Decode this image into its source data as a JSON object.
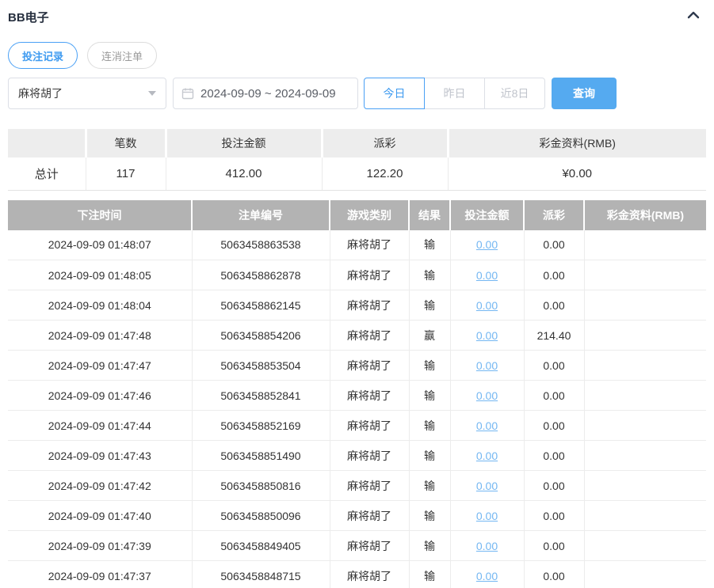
{
  "page": {
    "title": "BB电子"
  },
  "header": {
    "collapse_icon": "chevron-up-icon"
  },
  "tabs": [
    {
      "label": "投注记录",
      "active": true
    },
    {
      "label": "连消注单",
      "active": false
    }
  ],
  "filters": {
    "game_select": {
      "value": "麻将胡了",
      "icon": "caret-down-icon"
    },
    "date_range": {
      "value": "2024-09-09 ~ 2024-09-09",
      "icon": "calendar-icon"
    },
    "quick_buttons": [
      {
        "label": "今日",
        "active": true
      },
      {
        "label": "昨日",
        "active": false
      },
      {
        "label": "近8日",
        "active": false
      }
    ],
    "query_label": "查询"
  },
  "summary": {
    "columns": [
      "",
      "笔数",
      "投注金额",
      "派彩",
      "彩金资料(RMB)"
    ],
    "row": {
      "label": "总计",
      "count": "117",
      "bet_amount": "412.00",
      "payout": "122.20",
      "jackpot": "¥0.00"
    }
  },
  "table": {
    "columns": [
      "下注时间",
      "注单编号",
      "游戏类别",
      "结果",
      "投注金额",
      "派彩",
      "彩金资料(RMB)"
    ],
    "rows": [
      {
        "time": "2024-09-09 01:48:07",
        "order_no": "5063458863538",
        "game": "麻将胡了",
        "result": "输",
        "bet": "0.00",
        "payout": "0.00",
        "jackpot": ""
      },
      {
        "time": "2024-09-09 01:48:05",
        "order_no": "5063458862878",
        "game": "麻将胡了",
        "result": "输",
        "bet": "0.00",
        "payout": "0.00",
        "jackpot": ""
      },
      {
        "time": "2024-09-09 01:48:04",
        "order_no": "5063458862145",
        "game": "麻将胡了",
        "result": "输",
        "bet": "0.00",
        "payout": "0.00",
        "jackpot": ""
      },
      {
        "time": "2024-09-09 01:47:48",
        "order_no": "5063458854206",
        "game": "麻将胡了",
        "result": "赢",
        "bet": "0.00",
        "payout": "214.40",
        "jackpot": ""
      },
      {
        "time": "2024-09-09 01:47:47",
        "order_no": "5063458853504",
        "game": "麻将胡了",
        "result": "输",
        "bet": "0.00",
        "payout": "0.00",
        "jackpot": ""
      },
      {
        "time": "2024-09-09 01:47:46",
        "order_no": "5063458852841",
        "game": "麻将胡了",
        "result": "输",
        "bet": "0.00",
        "payout": "0.00",
        "jackpot": ""
      },
      {
        "time": "2024-09-09 01:47:44",
        "order_no": "5063458852169",
        "game": "麻将胡了",
        "result": "输",
        "bet": "0.00",
        "payout": "0.00",
        "jackpot": ""
      },
      {
        "time": "2024-09-09 01:47:43",
        "order_no": "5063458851490",
        "game": "麻将胡了",
        "result": "输",
        "bet": "0.00",
        "payout": "0.00",
        "jackpot": ""
      },
      {
        "time": "2024-09-09 01:47:42",
        "order_no": "5063458850816",
        "game": "麻将胡了",
        "result": "输",
        "bet": "0.00",
        "payout": "0.00",
        "jackpot": ""
      },
      {
        "time": "2024-09-09 01:47:40",
        "order_no": "5063458850096",
        "game": "麻将胡了",
        "result": "输",
        "bet": "0.00",
        "payout": "0.00",
        "jackpot": ""
      },
      {
        "time": "2024-09-09 01:47:39",
        "order_no": "5063458849405",
        "game": "麻将胡了",
        "result": "输",
        "bet": "0.00",
        "payout": "0.00",
        "jackpot": ""
      },
      {
        "time": "2024-09-09 01:47:37",
        "order_no": "5063458848715",
        "game": "麻将胡了",
        "result": "输",
        "bet": "0.00",
        "payout": "0.00",
        "jackpot": ""
      }
    ]
  },
  "colors": {
    "accent_blue": "#4aa0f5",
    "button_blue": "#55aaf0",
    "link_blue": "#74b7f2",
    "table_header_bg": "#b3b3b3",
    "summary_header_bg": "#ededed"
  }
}
